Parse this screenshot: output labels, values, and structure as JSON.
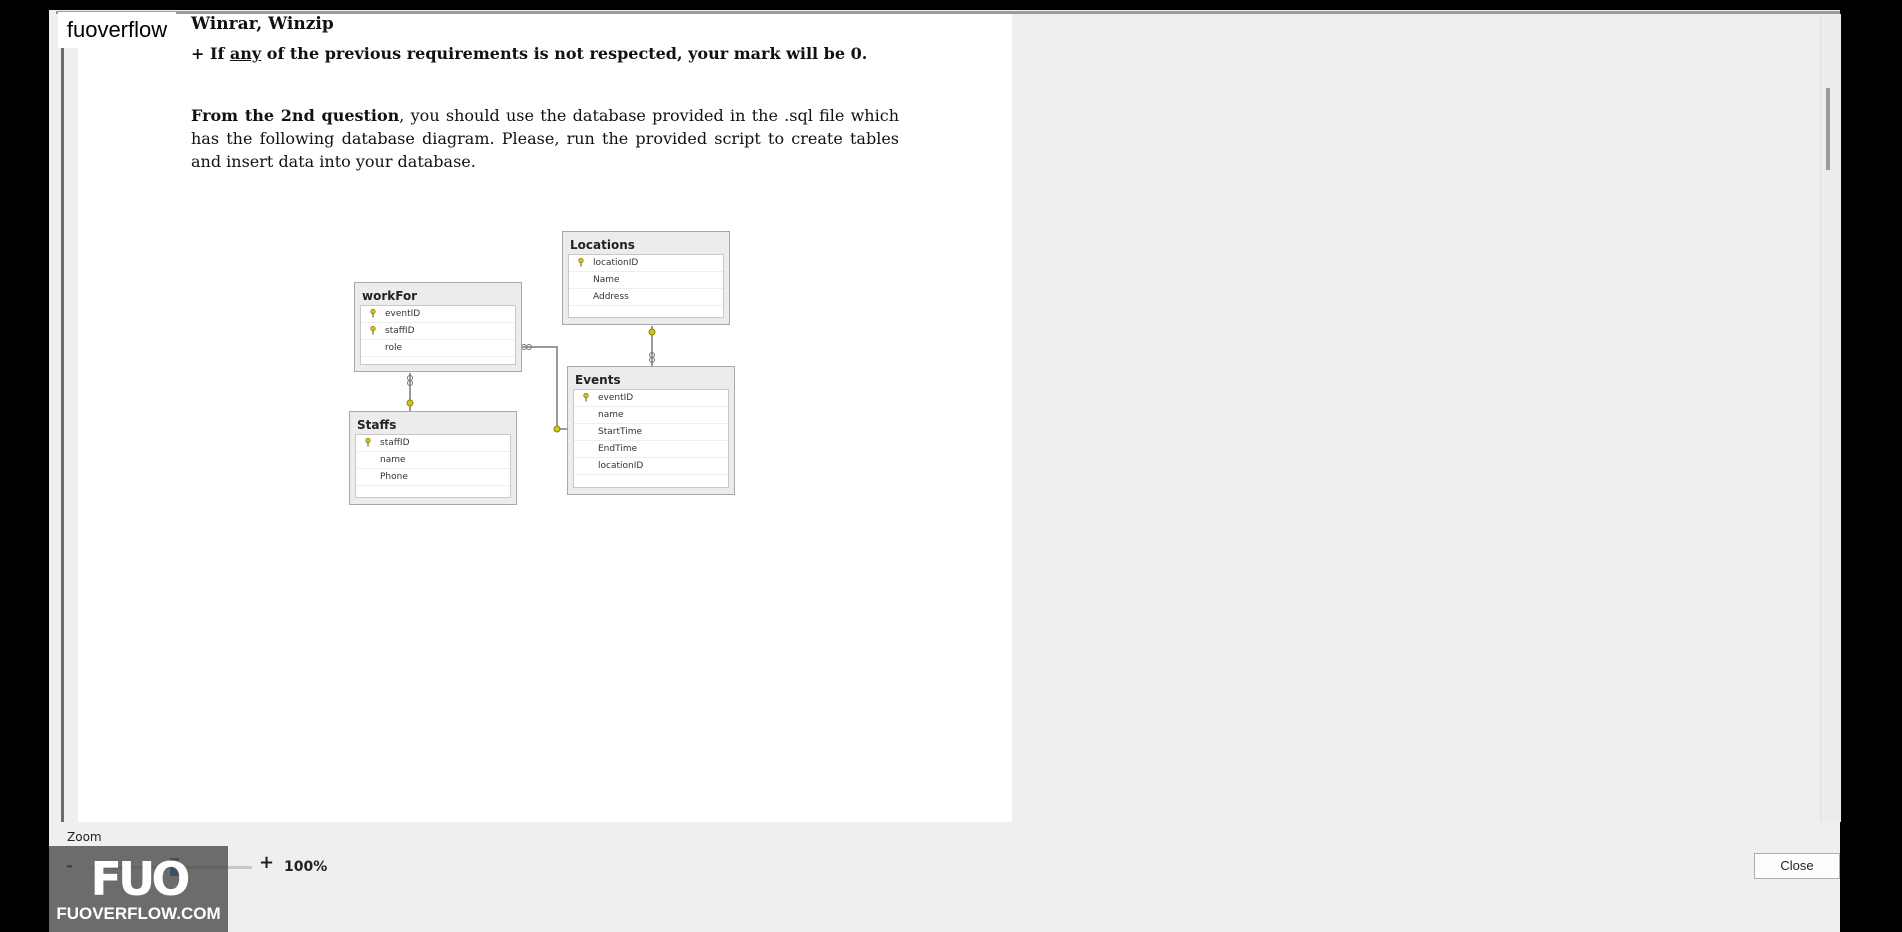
{
  "logo": {
    "text": "fuoverflow"
  },
  "document": {
    "title_line": "Winrar, Winzip",
    "requirement": {
      "prefix": "+ If ",
      "underlined": "any",
      "suffix": " of the previous requirements is not respected, your mark will be 0."
    },
    "paragraph": {
      "bold": "From the 2nd question",
      "rest": ", you should use the database provided in the .sql file which has the following database diagram. Please, run the provided script to create tables and insert data into your database."
    }
  },
  "diagram": {
    "tables": [
      {
        "name": "Locations",
        "rows": [
          {
            "field": "locationID",
            "key": true
          },
          {
            "field": "Name",
            "key": false
          },
          {
            "field": "Address",
            "key": false
          }
        ]
      },
      {
        "name": "workFor",
        "rows": [
          {
            "field": "eventID",
            "key": true
          },
          {
            "field": "staffID",
            "key": true
          },
          {
            "field": "role",
            "key": false
          }
        ]
      },
      {
        "name": "Events",
        "rows": [
          {
            "field": "eventID",
            "key": true
          },
          {
            "field": "name",
            "key": false
          },
          {
            "field": "StartTime",
            "key": false
          },
          {
            "field": "EndTime",
            "key": false
          },
          {
            "field": "locationID",
            "key": false
          }
        ]
      },
      {
        "name": "Staffs",
        "rows": [
          {
            "field": "staffID",
            "key": true
          },
          {
            "field": "name",
            "key": false
          },
          {
            "field": "Phone",
            "key": false
          }
        ]
      }
    ]
  },
  "zoom": {
    "label": "Zoom",
    "minus": "-",
    "plus": "+",
    "value": "100%"
  },
  "buttons": {
    "close": "Close"
  },
  "watermark": {
    "logo": "FUO",
    "text": "FUOVERFLOW.COM"
  },
  "colors": {
    "page_bg": "#ffffff",
    "window_bg": "#efefef",
    "key_color": "#d4c21a",
    "slider": "#1f6fc5"
  }
}
